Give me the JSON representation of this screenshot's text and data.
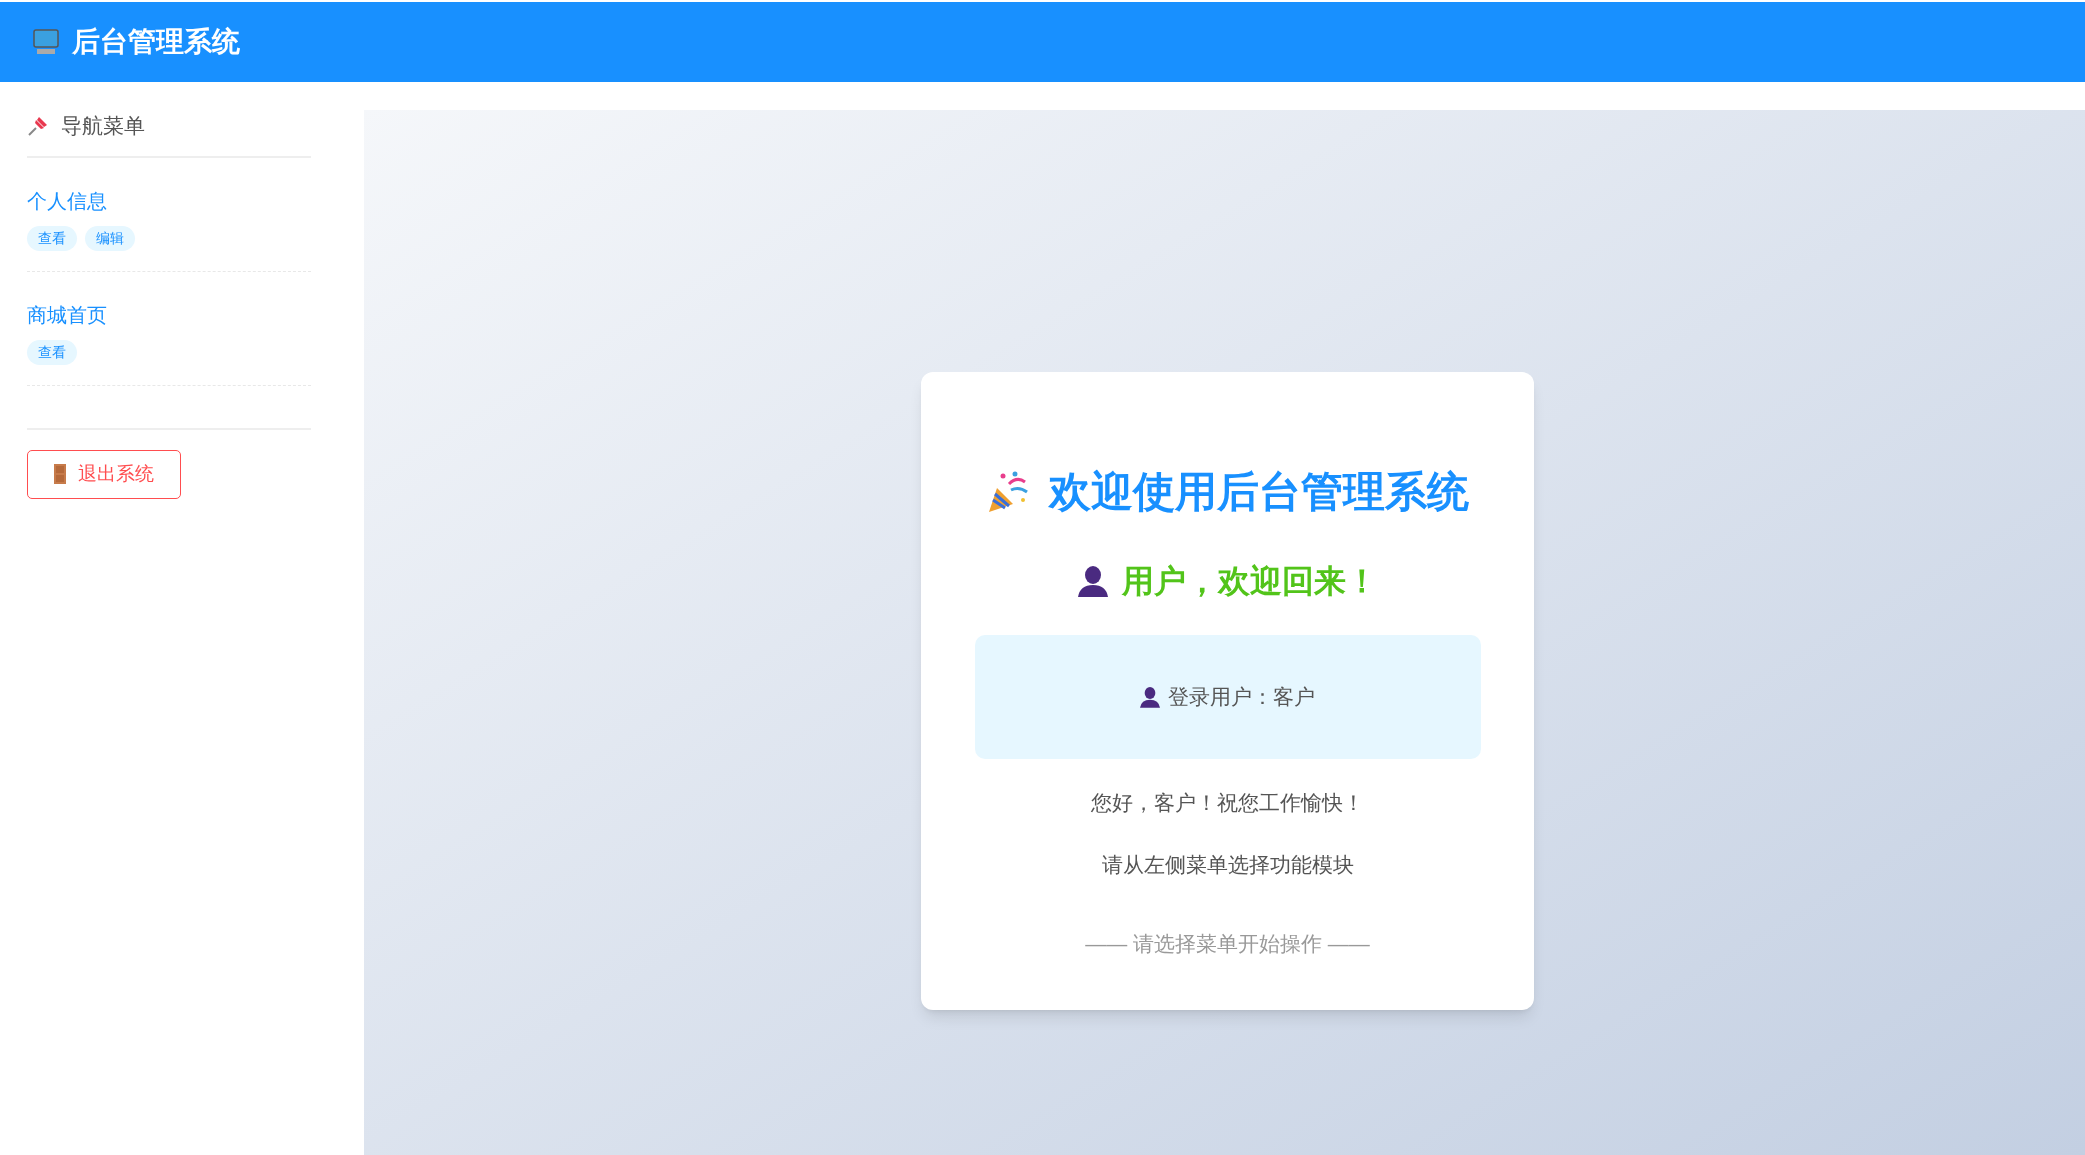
{
  "header": {
    "title": "后台管理系统"
  },
  "sidebar": {
    "heading": "导航菜单",
    "items": [
      {
        "title": "个人信息",
        "actions": [
          "查看",
          "编辑"
        ]
      },
      {
        "title": "商城首页",
        "actions": [
          "查看"
        ]
      }
    ],
    "logout_button": "退出系统"
  },
  "welcome_card": {
    "title": "欢迎使用后台管理系统",
    "greeting": "用户，欢迎回来！",
    "login_info": "登录用户：客户",
    "lines": [
      "您好，客户！祝您工作愉快！",
      "请从左侧菜单选择功能模块"
    ],
    "hint": "—— 请选择菜单开始操作 ——"
  }
}
